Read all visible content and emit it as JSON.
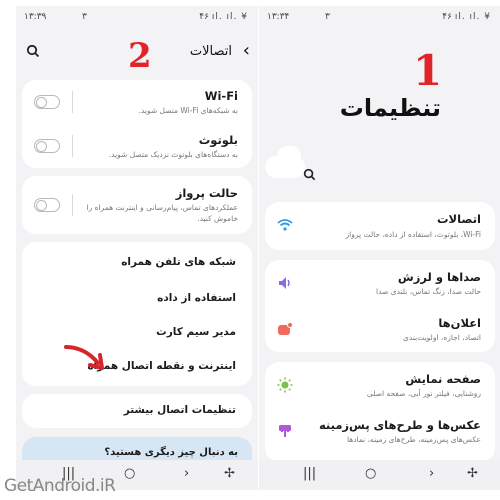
{
  "left": {
    "status": {
      "time": "۱۳:۳۹",
      "mid": "۳",
      "icons": "۴۶ ıl. ıl. ¥"
    },
    "header": {
      "title": "اتصالات"
    },
    "step": "2",
    "wifi": {
      "title": "Wi-Fi",
      "subtitle": "به شبکه‌های Wi-Fi متصل شوید."
    },
    "bluetooth": {
      "title": "بلوتوث",
      "subtitle": "به دستگاه‌های بلوتوث نزدیک متصل شوید."
    },
    "airplane": {
      "title": "حالت پرواز",
      "subtitle_line1": "عملکردهای تماس، پیام‌رسانی و اینترنت همراه را",
      "subtitle_line2": "خاموش کنید."
    },
    "list": [
      "شبکه های تلفن همراه",
      "استفاده از داده",
      "مدیر سیم کارت",
      "اینترنت و نقطه اتصال همراه"
    ],
    "more": "تنظیمات اتصال بیشتر",
    "promo": "به دنبال چیز دیگری هستید؟"
  },
  "right": {
    "status": {
      "time": "۱۳:۳۴",
      "mid": "۳",
      "icons": "۴۶ ıl. ıl. ¥"
    },
    "step": "1",
    "title": "تنظیمات",
    "items": [
      {
        "title": "اتصالات",
        "subtitle": "Wi-Fi، بلوتوث، استفاده از داده، حالت پرواز",
        "icon": "wifi-icon",
        "color": "#2f9be6"
      },
      {
        "title": "صداها و لرزش",
        "subtitle": "حالت صدا، زنگ تماس، بلندی صدا",
        "icon": "sound-icon",
        "color": "#8a6ae6"
      },
      {
        "title": "اعلان‌ها",
        "subtitle": "اتصاد، اجازه، اولویت‌بندی",
        "icon": "notification-icon",
        "color": "#f06a5e"
      },
      {
        "title": "صفحه نمایش",
        "subtitle": "روشنایی، فیلتر نور آبی، صفحه اصلی",
        "icon": "brightness-icon",
        "color": "#7ac24a"
      },
      {
        "title": "عکس‌ها و طرح‌های پس‌زمینه",
        "subtitle": "عکس‌های پس‌زمینه، طرح‌های زمینه، نمادها",
        "icon": "theme-icon",
        "color": "#b357d9"
      }
    ]
  },
  "watermark": "GetAndroid.iR"
}
